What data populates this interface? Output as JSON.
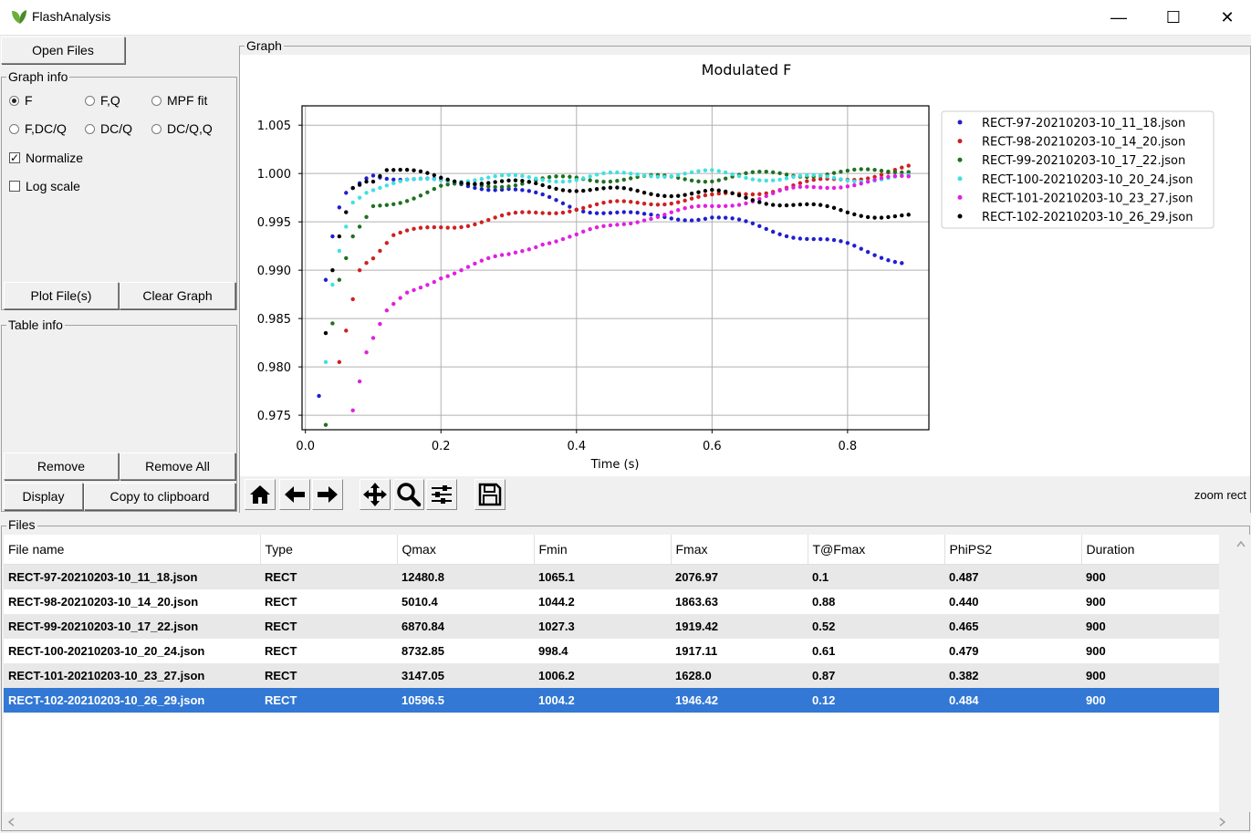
{
  "window": {
    "title": "FlashAnalysis",
    "minimize": "—",
    "maximize": "☐",
    "close": "✕"
  },
  "left": {
    "open_files": "Open Files",
    "graph_info_label": "Graph info",
    "radios": [
      {
        "label": "F",
        "checked": true
      },
      {
        "label": "F,Q",
        "checked": false
      },
      {
        "label": "MPF fit",
        "checked": false
      },
      {
        "label": "F,DC/Q",
        "checked": false
      },
      {
        "label": "DC/Q",
        "checked": false
      },
      {
        "label": "DC/Q,Q",
        "checked": false
      }
    ],
    "normalize": {
      "label": "Normalize",
      "checked": true
    },
    "logscale": {
      "label": "Log scale",
      "checked": false
    },
    "plot_files": "Plot File(s)",
    "clear_graph": "Clear Graph",
    "table_info_label": "Table info",
    "remove": "Remove",
    "remove_all": "Remove All",
    "display": "Display",
    "copy_clipboard": "Copy to clipboard"
  },
  "graph": {
    "group_label": "Graph",
    "status": "zoom rect",
    "toolbar_icons": [
      "home-icon",
      "back-arrow-icon",
      "forward-arrow-icon",
      "pan-icon",
      "zoom-icon",
      "configure-subplots-icon",
      "save-icon"
    ]
  },
  "chart_data": {
    "type": "scatter",
    "title": "Modulated F",
    "xlabel": "Time (s)",
    "ylabel": "",
    "xlim": [
      -0.005,
      0.92
    ],
    "ylim": [
      0.9735,
      1.007
    ],
    "xticks": [
      0.0,
      0.2,
      0.4,
      0.6,
      0.8
    ],
    "yticks": [
      0.975,
      0.98,
      0.985,
      0.99,
      0.995,
      1.0,
      1.005
    ],
    "grid": true,
    "legend_position": "outside-top-right",
    "series": [
      {
        "name": "RECT-97-20210203-10_11_18.json",
        "color": "#1f1fd0",
        "points": [
          [
            0.02,
            0.977
          ],
          [
            0.03,
            0.989
          ],
          [
            0.04,
            0.9935
          ],
          [
            0.05,
            0.9965
          ],
          [
            0.06,
            0.998
          ],
          [
            0.1,
            1.0
          ],
          [
            0.2,
            0.999
          ],
          [
            0.3,
            0.9985
          ],
          [
            0.4,
            0.9965
          ],
          [
            0.5,
            0.9955
          ],
          [
            0.6,
            0.9955
          ],
          [
            0.7,
            0.994
          ],
          [
            0.8,
            0.9925
          ],
          [
            0.88,
            0.991
          ]
        ]
      },
      {
        "name": "RECT-98-20210203-10_14_20.json",
        "color": "#d02020",
        "points": [
          [
            0.05,
            0.9805
          ],
          [
            0.07,
            0.987
          ],
          [
            0.08,
            0.99
          ],
          [
            0.1,
            0.9915
          ],
          [
            0.13,
            0.9935
          ],
          [
            0.2,
            0.9945
          ],
          [
            0.3,
            0.9955
          ],
          [
            0.4,
            0.9965
          ],
          [
            0.5,
            0.997
          ],
          [
            0.6,
            0.9975
          ],
          [
            0.7,
            0.9985
          ],
          [
            0.8,
            0.9995
          ],
          [
            0.89,
            1.0005
          ]
        ]
      },
      {
        "name": "RECT-99-20210203-10_17_22.json",
        "color": "#207020",
        "points": [
          [
            0.03,
            0.974
          ],
          [
            0.04,
            0.9845
          ],
          [
            0.05,
            0.989
          ],
          [
            0.07,
            0.9935
          ],
          [
            0.1,
            0.9965
          ],
          [
            0.15,
            0.9975
          ],
          [
            0.2,
            0.9985
          ],
          [
            0.3,
            0.999
          ],
          [
            0.4,
            0.9995
          ],
          [
            0.5,
            0.9995
          ],
          [
            0.6,
            0.9995
          ],
          [
            0.7,
            1.0
          ],
          [
            0.8,
            1.0
          ],
          [
            0.89,
            1.0005
          ]
        ]
      },
      {
        "name": "RECT-100-20210203-10_20_24.json",
        "color": "#40e0e0",
        "points": [
          [
            0.03,
            0.9805
          ],
          [
            0.04,
            0.9885
          ],
          [
            0.05,
            0.992
          ],
          [
            0.07,
            0.997
          ],
          [
            0.1,
            0.9985
          ],
          [
            0.2,
            0.9995
          ],
          [
            0.3,
            0.9995
          ],
          [
            0.4,
            0.9995
          ],
          [
            0.5,
            1.0
          ],
          [
            0.6,
            1.0
          ],
          [
            0.7,
            0.9995
          ],
          [
            0.8,
            0.9995
          ],
          [
            0.89,
            0.9995
          ]
        ]
      },
      {
        "name": "RECT-101-20210203-10_23_27.json",
        "color": "#e020e0",
        "points": [
          [
            0.07,
            0.9755
          ],
          [
            0.08,
            0.9785
          ],
          [
            0.09,
            0.9815
          ],
          [
            0.12,
            0.9855
          ],
          [
            0.15,
            0.9875
          ],
          [
            0.2,
            0.9895
          ],
          [
            0.25,
            0.9905
          ],
          [
            0.3,
            0.9915
          ],
          [
            0.35,
            0.993
          ],
          [
            0.4,
            0.9935
          ],
          [
            0.5,
            0.9955
          ],
          [
            0.6,
            0.9965
          ],
          [
            0.7,
            0.998
          ],
          [
            0.8,
            0.999
          ],
          [
            0.89,
            0.9995
          ]
        ]
      },
      {
        "name": "RECT-102-20210203-10_26_29.json",
        "color": "#000000",
        "points": [
          [
            0.03,
            0.9835
          ],
          [
            0.04,
            0.99
          ],
          [
            0.05,
            0.9935
          ],
          [
            0.07,
            0.9985
          ],
          [
            0.1,
            0.9995
          ],
          [
            0.12,
            1.0005
          ],
          [
            0.2,
            0.9995
          ],
          [
            0.3,
            0.999
          ],
          [
            0.4,
            0.9985
          ],
          [
            0.5,
            0.998
          ],
          [
            0.6,
            0.998
          ],
          [
            0.7,
            0.997
          ],
          [
            0.8,
            0.996
          ],
          [
            0.89,
            0.9955
          ]
        ]
      }
    ]
  },
  "files": {
    "group_label": "Files",
    "columns": [
      "File name",
      "Type",
      "Qmax",
      "Fmin",
      "Fmax",
      "T@Fmax",
      "PhiPS2",
      "Duration"
    ],
    "rows": [
      [
        "RECT-97-20210203-10_11_18.json",
        "RECT",
        "12480.8",
        "1065.1",
        "2076.97",
        "0.1",
        "0.487",
        "900"
      ],
      [
        "RECT-98-20210203-10_14_20.json",
        "RECT",
        "5010.4",
        "1044.2",
        "1863.63",
        "0.88",
        "0.440",
        "900"
      ],
      [
        "RECT-99-20210203-10_17_22.json",
        "RECT",
        "6870.84",
        "1027.3",
        "1919.42",
        "0.52",
        "0.465",
        "900"
      ],
      [
        "RECT-100-20210203-10_20_24.json",
        "RECT",
        "8732.85",
        "998.4",
        "1917.11",
        "0.61",
        "0.479",
        "900"
      ],
      [
        "RECT-101-20210203-10_23_27.json",
        "RECT",
        "3147.05",
        "1006.2",
        "1628.0",
        "0.87",
        "0.382",
        "900"
      ],
      [
        "RECT-102-20210203-10_26_29.json",
        "RECT",
        "10596.5",
        "1004.2",
        "1946.42",
        "0.12",
        "0.484",
        "900"
      ]
    ],
    "selected_row": 5
  }
}
